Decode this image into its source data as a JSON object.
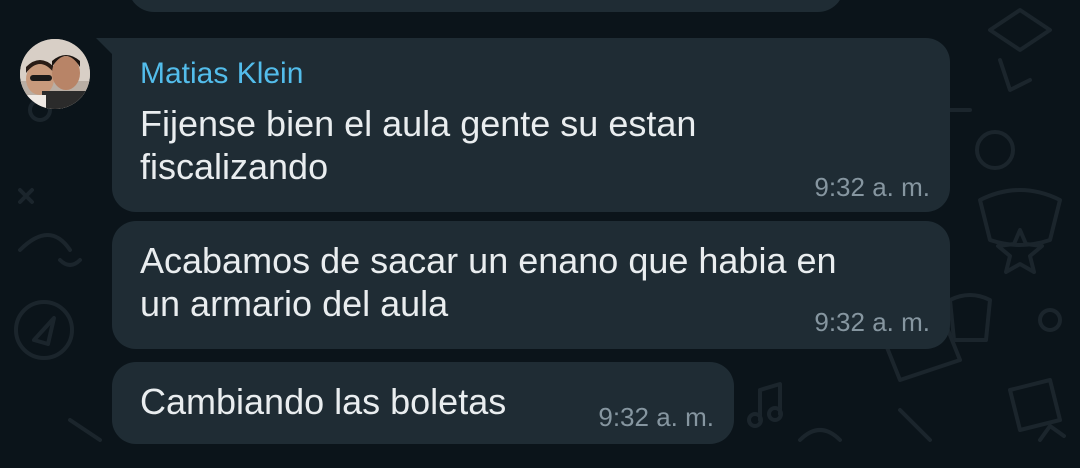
{
  "conversation": {
    "sender_name": "Matias Klein",
    "messages": [
      {
        "line1": "Fijense bien el aula gente su estan",
        "line2": "fiscalizando",
        "time": "9:32 a. m."
      },
      {
        "line1": "Acabamos de sacar un enano que habia en",
        "line2": "un armario del aula",
        "time": "9:32 a. m."
      },
      {
        "line1": "Cambiando las boletas",
        "time": "9:32 a. m."
      }
    ]
  },
  "colors": {
    "background": "#0b141a",
    "bubble": "#1f2c34",
    "sender_name": "#53bdeb",
    "message_text": "#e9edef",
    "timestamp": "#8696a0"
  }
}
